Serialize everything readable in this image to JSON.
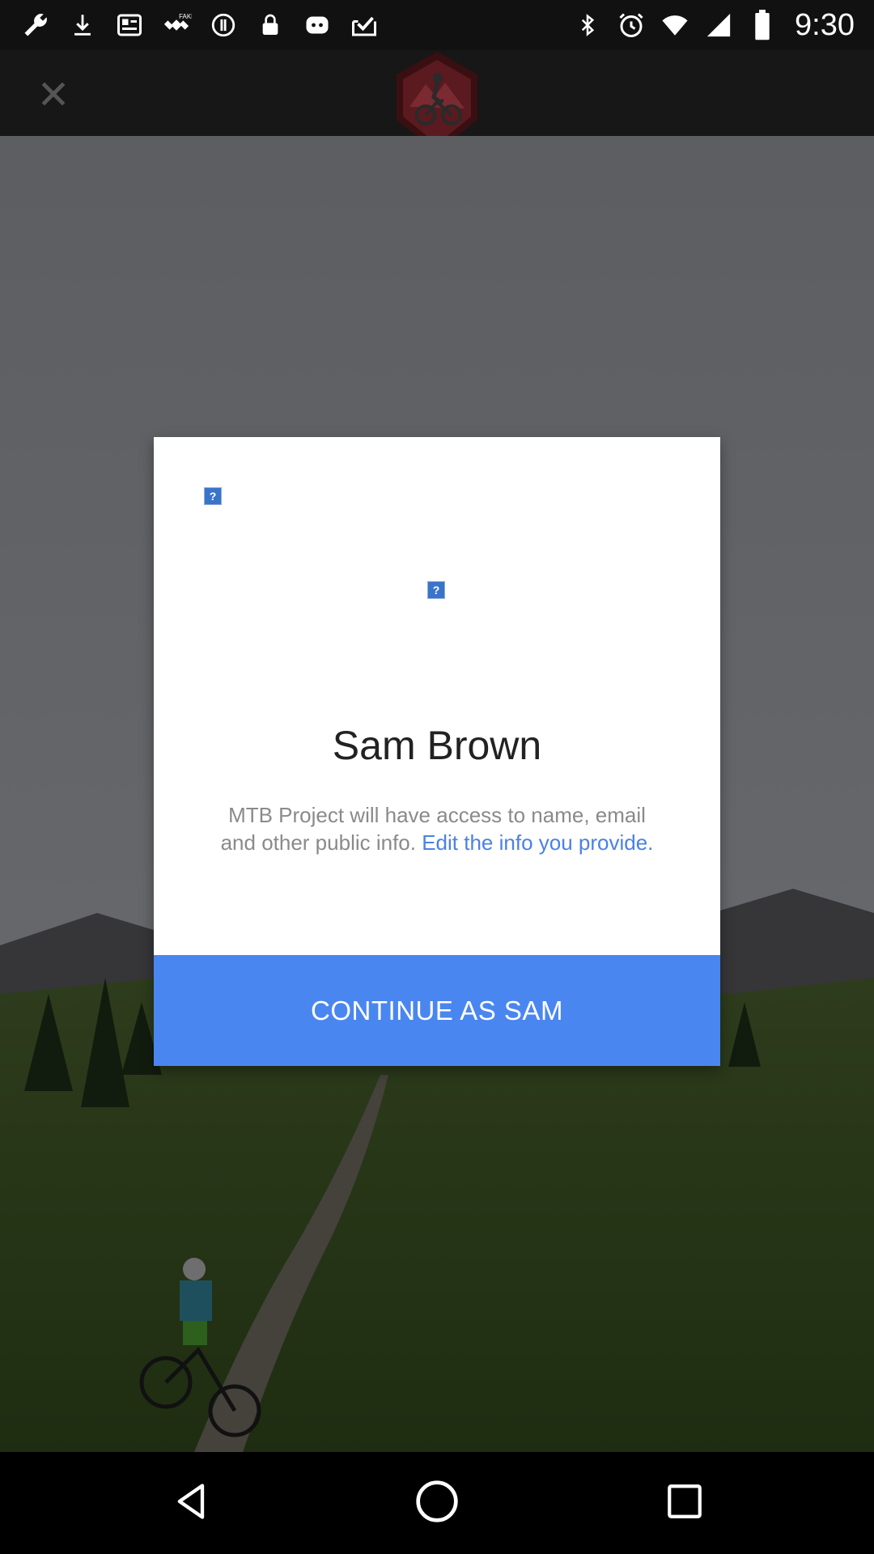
{
  "status_bar": {
    "time": "9:30",
    "left_icons": [
      "wrench-icon",
      "download-icon",
      "news-icon",
      "fake-gps-icon",
      "info-icon",
      "lock-icon",
      "app-icon",
      "check-inbox-icon"
    ],
    "right_icons": [
      "bluetooth-icon",
      "alarm-icon",
      "wifi-icon",
      "signal-icon",
      "battery-icon"
    ]
  },
  "toolbar": {
    "close_icon": "close-icon",
    "logo_icon": "mtb-cyclist-logo-icon"
  },
  "dialog": {
    "placeholder_glyph": "?",
    "user_name": "Sam Brown",
    "info_text": "MTB Project will have access to name, email and other public info. ",
    "edit_link": "Edit the info you provide.",
    "continue_label": "CONTINUE AS SAM"
  },
  "colors": {
    "accent": "#4A86F0",
    "link": "#4A80E8",
    "toolbar": "#171717"
  },
  "nav_bar": {
    "icons": [
      "back-icon",
      "home-icon",
      "recents-icon"
    ]
  }
}
